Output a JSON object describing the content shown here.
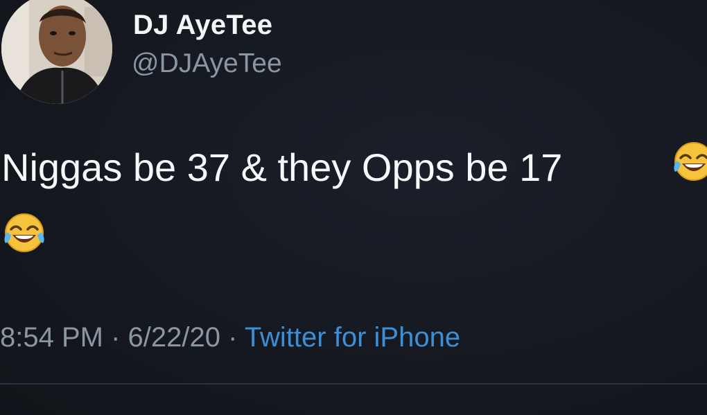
{
  "user": {
    "display_name": "DJ AyeTee",
    "handle": "@DJAyeTee",
    "avatar_icon": "user-avatar-photo"
  },
  "tweet": {
    "text": "Niggas be 37 & they Opps be 17",
    "emoji_1": "face-with-tears-of-joy-emoji",
    "emoji_2": "face-with-tears-of-joy-emoji"
  },
  "meta": {
    "time": "8:54 PM",
    "separator_1": " · ",
    "date": "6/22/20",
    "separator_2": " · ",
    "source": "Twitter for iPhone"
  },
  "colors": {
    "background": "#15181f",
    "text": "#f7f8fa",
    "secondary": "#8b96a3",
    "link": "#3a8fd6"
  }
}
